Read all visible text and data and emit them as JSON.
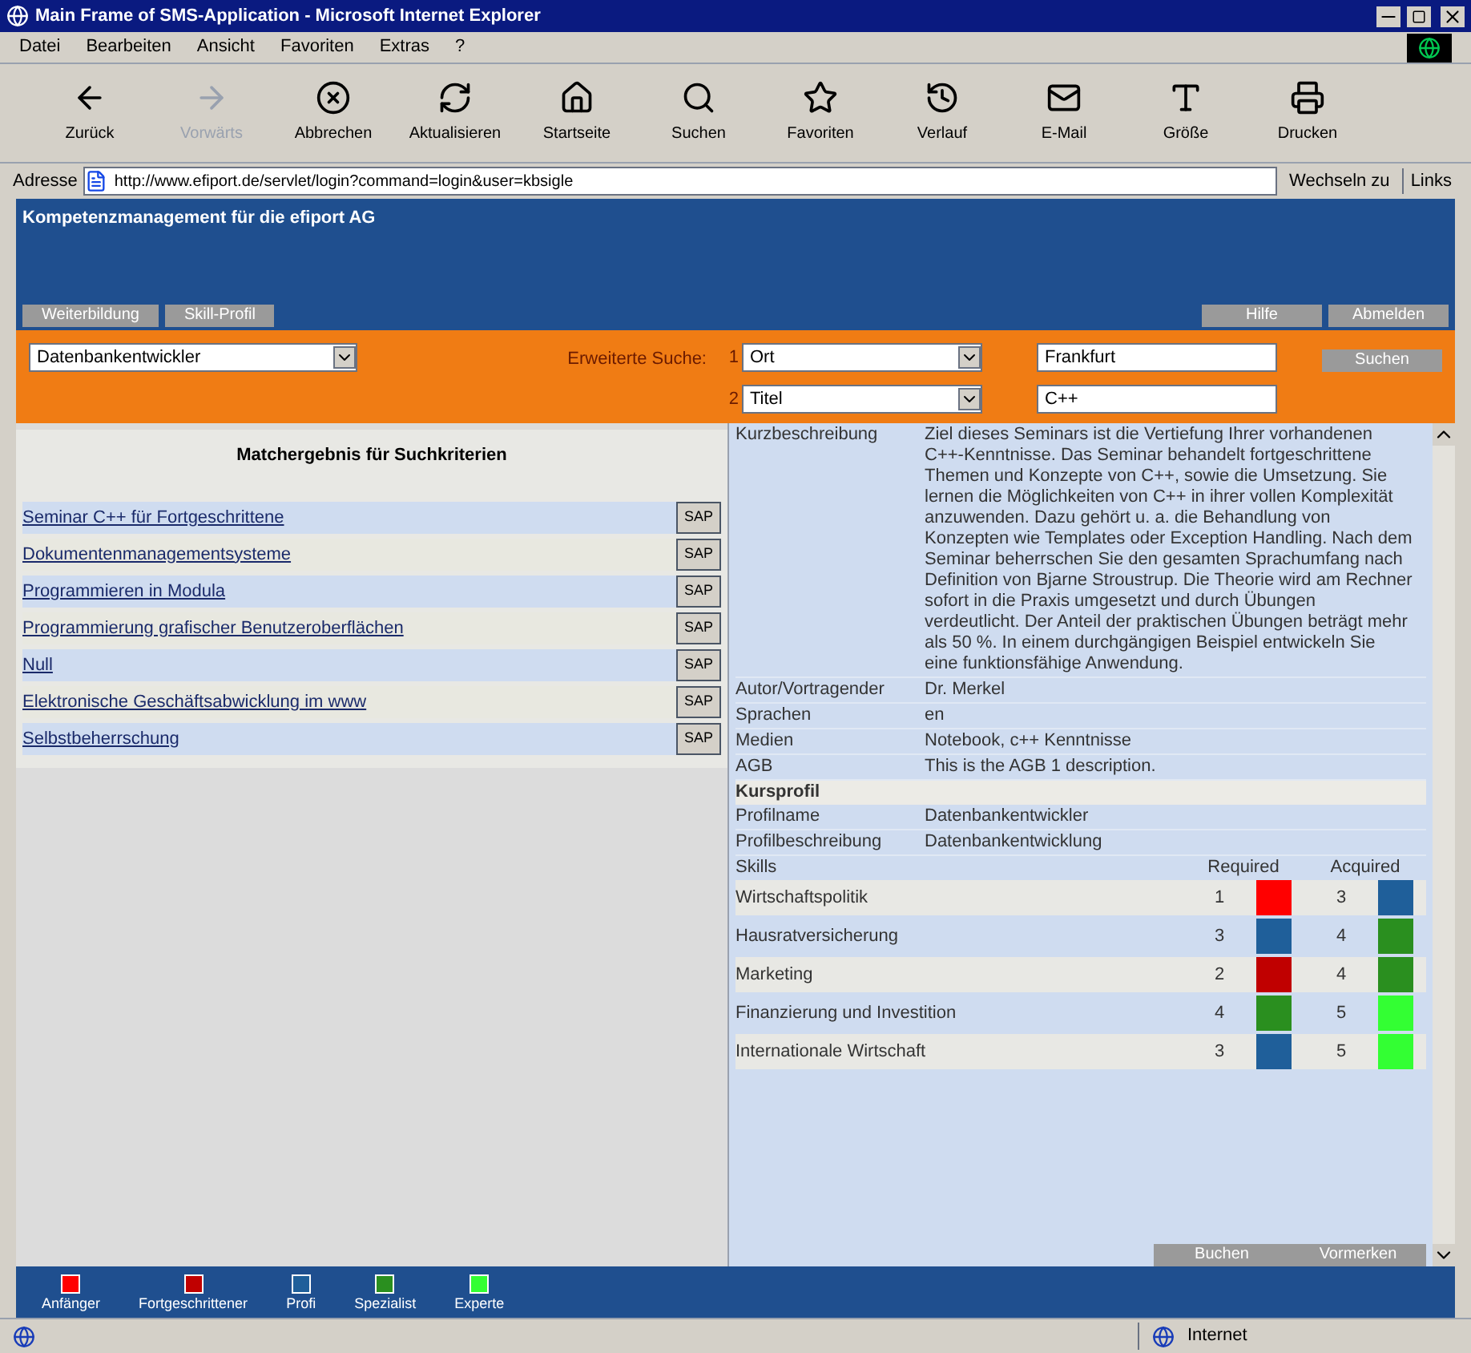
{
  "window": {
    "title": "Main Frame of SMS-Application - Microsoft Internet Explorer"
  },
  "menu": [
    "Datei",
    "Bearbeiten",
    "Ansicht",
    "Favoriten",
    "Extras",
    "?"
  ],
  "toolbar": [
    {
      "kind": "back",
      "label": "Zurück",
      "disabled": false
    },
    {
      "kind": "forward",
      "label": "Vorwärts",
      "disabled": true
    },
    {
      "kind": "stop",
      "label": "Abbrechen",
      "disabled": false
    },
    {
      "kind": "refresh",
      "label": "Aktualisieren",
      "disabled": false
    },
    {
      "kind": "home",
      "label": "Startseite",
      "disabled": false
    },
    {
      "kind": "search",
      "label": "Suchen",
      "disabled": false
    },
    {
      "kind": "favorites",
      "label": "Favoriten",
      "disabled": false
    },
    {
      "kind": "history",
      "label": "Verlauf",
      "disabled": false
    },
    {
      "kind": "mail",
      "label": "E-Mail",
      "disabled": false
    },
    {
      "kind": "size",
      "label": "Größe",
      "disabled": false
    },
    {
      "kind": "print",
      "label": "Drucken",
      "disabled": false
    }
  ],
  "address_bar": {
    "label": "Adresse",
    "url": "http://www.efiport.de/servlet/login?command=login&user=kbsigle",
    "go": "Wechseln zu",
    "links": "Links"
  },
  "header": {
    "title": "Kompetenzmanagement für die efiport AG",
    "nav_left": [
      "Weiterbildung",
      "Skill-Profil"
    ],
    "nav_right": [
      "Hilfe",
      "Abmelden"
    ]
  },
  "search": {
    "profile": "Datenbankentwickler",
    "label": "Erweiterte Suche:",
    "criteria": [
      {
        "number": "1",
        "field": "Ort",
        "value": "Frankfurt"
      },
      {
        "number": "2",
        "field": "Titel",
        "value": "C++"
      }
    ],
    "button": "Suchen"
  },
  "results": {
    "title": "Matchergebnis für Suchkriterien",
    "items": [
      {
        "label": "Seminar C++ für Fortgeschrittene",
        "action": "SAP"
      },
      {
        "label": "Dokumentenmanagementsysteme",
        "action": "SAP"
      },
      {
        "label": "Programmieren in Modula",
        "action": "SAP"
      },
      {
        "label": "Programmierung grafischer Benutzeroberflächen",
        "action": "SAP"
      },
      {
        "label": "Null",
        "action": "SAP"
      },
      {
        "label": "Elektronische Geschäftsabwicklung im www",
        "action": "SAP"
      },
      {
        "label": "Selbstbeherrschung",
        "action": "SAP"
      }
    ]
  },
  "details": {
    "rows": [
      {
        "kind": "field",
        "label": "Kurzbeschreibung",
        "value": "Ziel dieses Seminars ist die Vertiefung Ihrer vorhandenen C++-Kenntnisse. Das Seminar behandelt fortgeschrittene Themen und Konzepte von C++, sowie die Umsetzung. Sie lernen die Möglichkeiten von C++ in ihrer vollen Komplexität anzuwenden. Dazu gehört u. a. die Behandlung von Konzepten wie Templates oder Exception Handling. Nach dem Seminar beherrschen Sie den gesamten Sprachumfang nach Definition von Bjarne Stroustrup. Die Theorie wird am Rechner sofort in die Praxis umgesetzt und durch Übungen verdeutlicht. Der Anteil der praktischen Übungen beträgt mehr als 50 %. In einem durchgängigen Beispiel entwickeln Sie eine funktionsfähige Anwendung."
      },
      {
        "kind": "field",
        "label": "Autor/Vortragender",
        "value": "Dr. Merkel"
      },
      {
        "kind": "field",
        "label": "Sprachen",
        "value": "en"
      },
      {
        "kind": "field",
        "label": "Medien",
        "value": "Notebook, c++ Kenntnisse"
      },
      {
        "kind": "field",
        "label": "AGB",
        "value": "This is the AGB 1 description."
      },
      {
        "kind": "section",
        "label": "Kursprofil"
      },
      {
        "kind": "field",
        "label": "Profilname",
        "value": "Datenbankentwickler"
      },
      {
        "kind": "field",
        "label": "Profilbeschreibung",
        "value": "Datenbankentwicklung"
      }
    ],
    "skills": {
      "columns": [
        "Skills",
        "Required",
        "Acquired"
      ],
      "rows": [
        {
          "name": "Wirtschaftspolitik",
          "required": {
            "value": "1",
            "color": "#ff0000"
          },
          "acquired": {
            "value": "3",
            "color": "#1f5f9a"
          }
        },
        {
          "name": "Hausratversicherung",
          "required": {
            "value": "3",
            "color": "#1f5f9a"
          },
          "acquired": {
            "value": "4",
            "color": "#2a8f1f"
          }
        },
        {
          "name": "Marketing",
          "required": {
            "value": "2",
            "color": "#c00000"
          },
          "acquired": {
            "value": "4",
            "color": "#2a8f1f"
          }
        },
        {
          "name": "Finanzierung und Investition",
          "required": {
            "value": "4",
            "color": "#2a8f1f"
          },
          "acquired": {
            "value": "5",
            "color": "#33ff33"
          }
        },
        {
          "name": "Internationale Wirtschaft",
          "required": {
            "value": "3",
            "color": "#1f5f9a"
          },
          "acquired": {
            "value": "5",
            "color": "#33ff33"
          }
        }
      ]
    },
    "buttons": [
      "Buchen",
      "Vormerken"
    ]
  },
  "legend": [
    {
      "label": "Anfänger",
      "color": "#ff0000"
    },
    {
      "label": "Fortgeschrittener",
      "color": "#c00000"
    },
    {
      "label": "Profi",
      "color": "#1f5f9a"
    },
    {
      "label": "Spezialist",
      "color": "#2a8f1f"
    },
    {
      "label": "Experte",
      "color": "#33ff33"
    }
  ],
  "status_bar": {
    "zone": "Internet"
  }
}
